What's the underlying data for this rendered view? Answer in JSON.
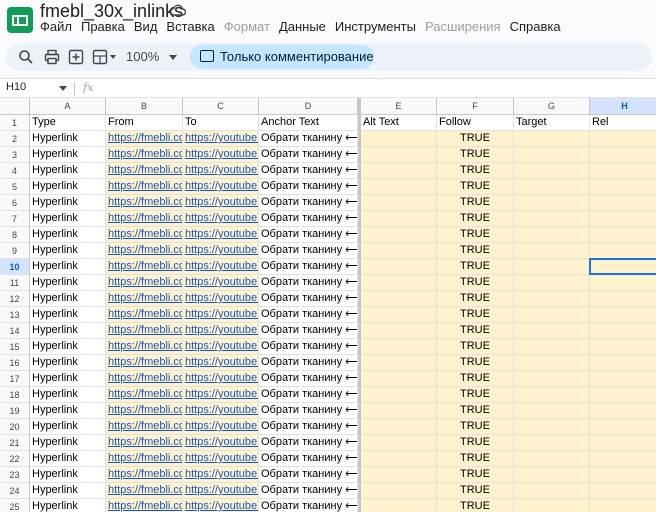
{
  "title": "fmebl_30x_inlinks",
  "menu": [
    {
      "label": "Файл",
      "disabled": false
    },
    {
      "label": "Правка",
      "disabled": false
    },
    {
      "label": "Вид",
      "disabled": false
    },
    {
      "label": "Вставка",
      "disabled": false
    },
    {
      "label": "Формат",
      "disabled": true
    },
    {
      "label": "Данные",
      "disabled": false
    },
    {
      "label": "Инструменты",
      "disabled": false
    },
    {
      "label": "Расширения",
      "disabled": true
    },
    {
      "label": "Справка",
      "disabled": false
    }
  ],
  "toolbar": {
    "zoom": "100%",
    "mode_label": "Только комментирование"
  },
  "formula": {
    "namebox": "H10",
    "fx": "fx"
  },
  "columns": [
    {
      "letter": "A"
    },
    {
      "letter": "B"
    },
    {
      "letter": "C"
    },
    {
      "letter": "D"
    },
    {
      "letter": "E"
    },
    {
      "letter": "F"
    },
    {
      "letter": "G"
    },
    {
      "letter": "H"
    }
  ],
  "selected_cell": "H10",
  "header_row": [
    "Type",
    "From",
    "To",
    "Anchor Text",
    "Alt Text",
    "Follow",
    "Target",
    "Rel"
  ],
  "data_rows": {
    "row_numbers": [
      "2",
      "3",
      "4",
      "5",
      "6",
      "7",
      "8",
      "9",
      "10",
      "11",
      "12",
      "13",
      "14",
      "15",
      "16",
      "17",
      "18",
      "19",
      "20",
      "21",
      "22",
      "23",
      "24",
      "25"
    ],
    "type": "Hyperlink",
    "from": "https://fmebli.com",
    "to": "https://youtube.com",
    "anchor_text": "Обрати тканину ⟵",
    "alt_text": "",
    "follow": "TRUE",
    "target": "",
    "rel": ""
  },
  "colors": {
    "fill": "#fff2cc",
    "link": "#1155cc",
    "selection": "#1a73e8"
  }
}
